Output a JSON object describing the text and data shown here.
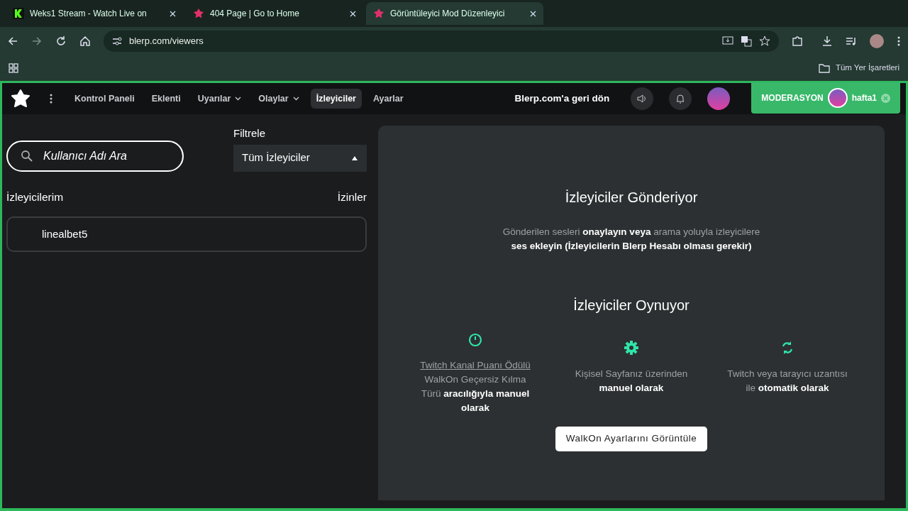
{
  "browser": {
    "tabs": [
      {
        "title": "Weks1 Stream - Watch Live on",
        "selected": false
      },
      {
        "title": "404 Page | Go to Home",
        "selected": false
      },
      {
        "title": "Görüntüleyici Mod Düzenleyici",
        "selected": true
      }
    ],
    "address": "blerp.com/viewers",
    "bookmarks_label": "Tüm Yer İşaretleri"
  },
  "app": {
    "nav": [
      {
        "label": "Kontrol Paneli",
        "dropdown": false,
        "selected": false
      },
      {
        "label": "Eklenti",
        "dropdown": false,
        "selected": false
      },
      {
        "label": "Uyarılar",
        "dropdown": true,
        "selected": false
      },
      {
        "label": "Olaylar",
        "dropdown": true,
        "selected": false
      },
      {
        "label": "İzleyiciler",
        "dropdown": false,
        "selected": true
      },
      {
        "label": "Ayarlar",
        "dropdown": false,
        "selected": false
      }
    ],
    "back_link": "Blerp.com'a geri dön",
    "mod_label": "MODERASYON",
    "mod_user": "hafta1"
  },
  "search": {
    "placeholder": "Kullanıcı Adı Ara"
  },
  "filter": {
    "label": "Filtrele",
    "value": "Tüm İzleyiciler"
  },
  "list": {
    "title": "İzleyicilerim",
    "permissions": "İzinler",
    "viewers": [
      "linealbet5"
    ]
  },
  "panel": {
    "sending_title": "İzleyiciler Gönderiyor",
    "sending_text": "Gönderilen sesleri **onaylayın veya** arama yoluyla izleyicilere **ses ekleyin (İzleyicilerin Blerp Hesabı olması gerekir)**",
    "playing_title": "İzleyiciler Oynuyor",
    "ways": [
      {
        "link": "Twitch Kanal Puanı Ödülü",
        "text": "WalkOn Geçersiz Kılma Türü **aracılığıyla manuel olarak**"
      },
      {
        "text": "Kişisel Sayfanız üzerinden **manuel olarak**"
      },
      {
        "text": "Twitch veya tarayıcı uzantısı ile **otomatik olarak**"
      }
    ],
    "button": "WalkOn Ayarlarını Görüntüle"
  }
}
